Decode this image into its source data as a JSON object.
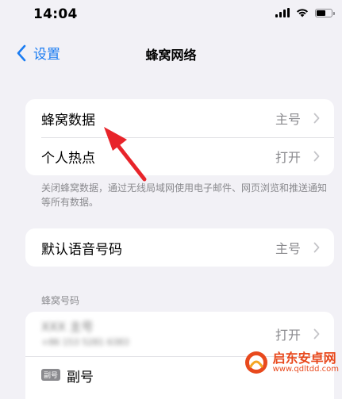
{
  "status_bar": {
    "time": "14:04",
    "icons": [
      "signal-icon",
      "wifi-icon",
      "battery-icon"
    ]
  },
  "nav": {
    "back_label": "设置",
    "title": "蜂窝网络"
  },
  "group1": {
    "rows": [
      {
        "label": "蜂窝数据",
        "value": "主号"
      },
      {
        "label": "个人热点",
        "value": "打开"
      }
    ]
  },
  "footer_note": "关闭蜂窝数据，通过无线局域网使用电子邮件、网页浏览和推送通知等所有数据。",
  "group2": {
    "rows": [
      {
        "label": "默认语音号码",
        "value": "主号"
      }
    ]
  },
  "section_header": "蜂窝号码",
  "group3": {
    "rows": [
      {
        "title": "XXX 主号",
        "subtitle": "+86 153 5281 6383",
        "value": "打开"
      },
      {
        "badge": "副号",
        "label": "副号"
      }
    ]
  },
  "watermark": {
    "name": "启东安卓网",
    "url": "www.qdltdd.com"
  },
  "colors": {
    "accent": "#1a7cf2",
    "background": "#f2f1f6",
    "secondary_text": "#8a8a8e",
    "annotation_arrow": "#e8242a",
    "watermark": "#e8491d"
  }
}
